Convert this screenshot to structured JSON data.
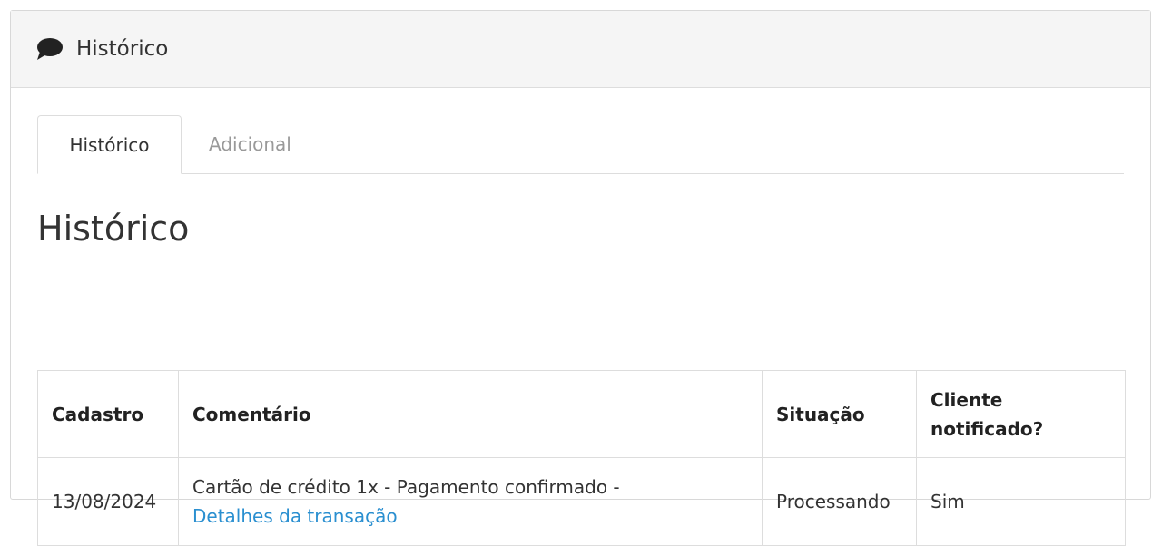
{
  "panel": {
    "title": "Histórico",
    "icon": "comment-icon"
  },
  "tabs": [
    {
      "label": "Histórico",
      "active": true
    },
    {
      "label": "Adicional",
      "active": false
    }
  ],
  "section": {
    "title": "Histórico"
  },
  "table": {
    "headers": {
      "cadastro": "Cadastro",
      "comentario": "Comentário",
      "situacao": "Situação",
      "cliente_notificado": "Cliente notificado?"
    },
    "rows": [
      {
        "cadastro": "13/08/2024",
        "comentario": "Cartão de crédito 1x - Pagamento confirmado -",
        "link": "Detalhes da transação",
        "situacao": "Processando",
        "cliente_notificado": "Sim"
      }
    ]
  },
  "colors": {
    "link": "#2a8fd0",
    "heading_bg": "#f5f5f5",
    "border": "#dddddd"
  }
}
